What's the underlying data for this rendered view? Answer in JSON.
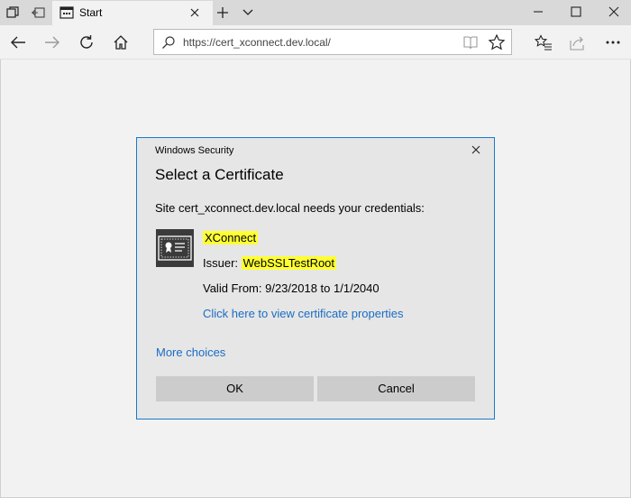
{
  "browser": {
    "tab": {
      "title": "Start"
    },
    "address": {
      "url": "https://cert_xconnect.dev.local/"
    }
  },
  "icons": {
    "tab_actions": "tab-actions-icon",
    "set_aside": "set-aside-tabs-icon",
    "tab_favicon": "start-page-icon",
    "tab_close": "close-icon",
    "new_tab": "plus-icon",
    "tab_preview": "chevron-down-icon",
    "minimize": "minimize-icon",
    "maximize": "maximize-icon",
    "window_close": "close-icon",
    "back": "back-arrow-icon",
    "forward": "forward-arrow-icon",
    "refresh": "refresh-icon",
    "home": "home-icon",
    "search": "search-icon",
    "reading_view": "book-icon",
    "favorite": "star-icon",
    "favorites_hub": "favorites-list-icon",
    "share": "share-icon",
    "more": "more-icon",
    "certificate": "certificate-icon"
  },
  "dialog": {
    "caption": "Windows Security",
    "heading": "Select a Certificate",
    "message": "Site cert_xconnect.dev.local needs your credentials:",
    "certificate": {
      "name": "XConnect",
      "issuer_label": "Issuer: ",
      "issuer": "WebSSLTestRoot",
      "valid": "Valid From: 9/23/2018 to 1/1/2040",
      "link": "Click here to view certificate properties"
    },
    "more_choices": "More choices",
    "ok_label": "OK",
    "cancel_label": "Cancel"
  },
  "colors": {
    "accent": "#1979ca",
    "link": "#1a6dc4",
    "highlight": "#ffff33",
    "button": "#cccccc",
    "dialog_bg": "#e6e6e6",
    "page_bg": "#f2f2f2"
  }
}
